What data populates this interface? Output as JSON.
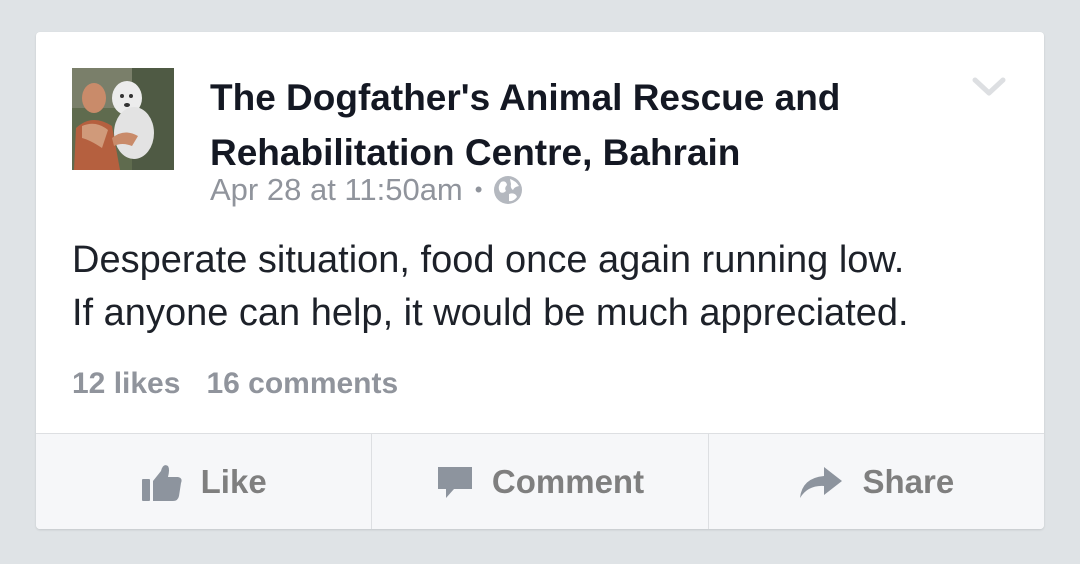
{
  "post": {
    "page_name": "The Dogfather's Animal Rescue and Rehabilitation Centre, Bahrain",
    "timestamp": "Apr 28 at 11:50am",
    "separator": "•",
    "audience_icon": "globe-icon",
    "menu_icon": "chevron-down-icon",
    "text": "Desperate situation, food once again running low.\nIf anyone can help, it would be much appreciated."
  },
  "stats": {
    "likes": "12 likes",
    "comments": "16 comments"
  },
  "actions": {
    "like": {
      "label": "Like",
      "icon": "thumbs-up-icon"
    },
    "comment": {
      "label": "Comment",
      "icon": "speech-bubble-icon"
    },
    "share": {
      "label": "Share",
      "icon": "share-arrow-icon"
    }
  },
  "colors": {
    "background": "#dfe3e6",
    "card": "#ffffff",
    "name_text": "#141823",
    "secondary_text": "#90949c",
    "action_text": "#7f7f7f",
    "action_bar": "#f6f7f9"
  }
}
